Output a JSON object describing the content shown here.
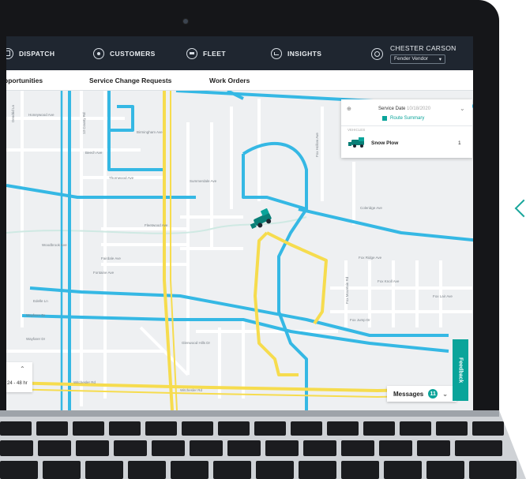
{
  "nav": {
    "items": [
      {
        "label": "DISPATCH",
        "icon": "dispatch-icon"
      },
      {
        "label": "CUSTOMERS",
        "icon": "user-icon"
      },
      {
        "label": "FLEET",
        "icon": "truck-icon"
      },
      {
        "label": "INSIGHTS",
        "icon": "chart-icon"
      }
    ],
    "user_name": "CHESTER CARSON",
    "vendor": "Fender Vendor"
  },
  "subnav": {
    "tabs": [
      "pportunities",
      "Service Change Requests",
      "Work Orders"
    ]
  },
  "map": {
    "streets": [
      "Dendrid Ln",
      "Honeywood Ave",
      "13 County Rd",
      "Birmingham Ave",
      "Beech Ave",
      "Thornwood Ave",
      "Summerdale Ave",
      "Fleetwood Ave",
      "Woodbrook Ave",
      "Fairdale Ave",
      "Fontaine Ave",
      "Edelle Ln",
      "Wayfarer Dr",
      "Wayfarer Dr",
      "Glenwood Hills Dr",
      "Witchesler Rd",
      "Witchesler Rd",
      "Fox Ridge Ave",
      "Fox Knoll Ave",
      "Fox Lair Ave",
      "Fox Mountain Rd",
      "Fox Jump Dr",
      "Fox Hollow Ave",
      "Coleridge Ave"
    ],
    "route_colors": {
      "primary": "#35b8e4",
      "secondary": "#f6dc4e"
    }
  },
  "panel": {
    "service_date_label": "Service Date",
    "service_date": "10/18/2020",
    "route_summary": "Route Summary",
    "section_label": "VEHICLES",
    "vehicle": "Snow Plow",
    "count": "1"
  },
  "zoom": {
    "range": "24 - 48 hr"
  },
  "messages": {
    "label": "Messages",
    "count": "11"
  },
  "feedback": {
    "label": "Feedback"
  },
  "colors": {
    "nav_bg": "#1f2630",
    "accent": "#0aa49a",
    "map_bg": "#eef0f2"
  }
}
